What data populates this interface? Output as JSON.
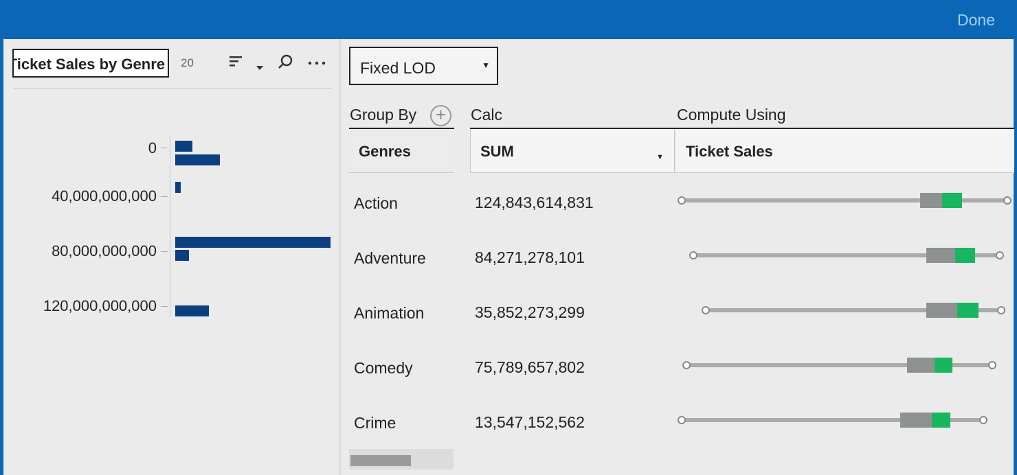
{
  "header": {
    "done_label": "Done"
  },
  "left_pane": {
    "field_name": "Ticket Sales by Genre",
    "count": "20",
    "icons": [
      "sort-icon",
      "chevron-down-icon",
      "search-icon",
      "more-icon"
    ]
  },
  "chart_data": {
    "type": "bar",
    "orientation": "horizontal",
    "axis_tick_labels": [
      "0",
      "40,000,000,000",
      "80,000,000,000",
      "120,000,000,000"
    ],
    "values": [
      13547152562,
      35852273299,
      4200000000,
      124843614831,
      11000000000,
      27000000000
    ],
    "xlim": [
      0,
      124843614831
    ]
  },
  "right_pane": {
    "calc_type": "Fixed LOD",
    "group_by_header": "Group By",
    "calc_header": "Calc",
    "compute_using_header": "Compute Using",
    "group_by_field": "Genres",
    "aggregation": "SUM",
    "compute_field": "Ticket Sales",
    "rows": [
      {
        "genre": "Action",
        "value": "124,843,614,831"
      },
      {
        "genre": "Adventure",
        "value": "84,271,278,101"
      },
      {
        "genre": "Animation",
        "value": "35,852,273,299"
      },
      {
        "genre": "Comedy",
        "value": "75,789,657,802"
      },
      {
        "genre": "Crime",
        "value": "13,547,152,562"
      }
    ]
  },
  "colors": {
    "accent": "#0b67b5",
    "bar": "#0b3f80",
    "green": "#17b65f",
    "gray": "#8d9190"
  }
}
